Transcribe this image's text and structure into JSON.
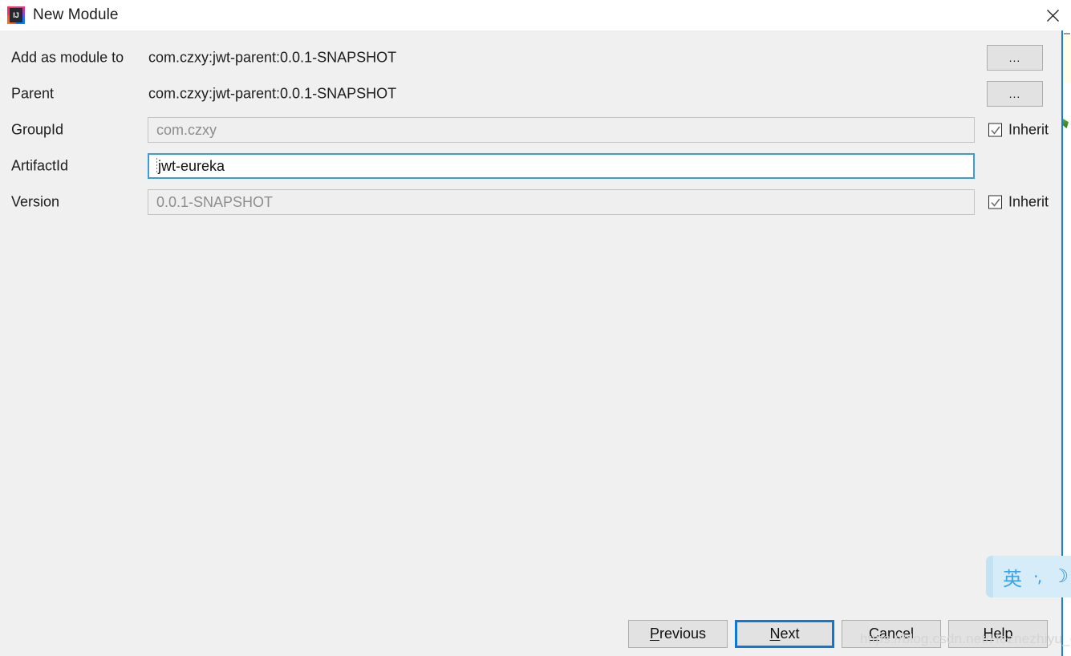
{
  "window": {
    "title": "New Module",
    "app_icon": "intellij-idea-icon",
    "app_icon_text": "IJ",
    "close_icon": "close-icon"
  },
  "form": {
    "rows": [
      {
        "label": "Add as module to",
        "type": "static",
        "value": "com.czxy:jwt-parent:0.0.1-SNAPSHOT",
        "trailing": "browse-button",
        "trailing_label": "...",
        "name": "add-as-module-to"
      },
      {
        "label": "Parent",
        "type": "static",
        "value": "com.czxy:jwt-parent:0.0.1-SNAPSHOT",
        "trailing": "browse-button",
        "trailing_label": "...",
        "name": "parent"
      },
      {
        "label": "GroupId",
        "type": "input",
        "value": "com.czxy",
        "state": "disabled",
        "trailing": "inherit-checkbox",
        "trailing_label": "Inherit",
        "checked": true,
        "name": "groupid"
      },
      {
        "label": "ArtifactId",
        "type": "input",
        "value": "jwt-eureka",
        "state": "focused",
        "trailing": "none",
        "trailing_label": "",
        "checked": false,
        "name": "artifactid"
      },
      {
        "label": "Version",
        "type": "input",
        "value": "0.0.1-SNAPSHOT",
        "state": "disabled",
        "trailing": "inherit-checkbox",
        "trailing_label": "Inherit",
        "checked": true,
        "name": "version"
      }
    ]
  },
  "ime": {
    "mode": "英",
    "punctuation": "·,",
    "moon": "☽"
  },
  "buttons": [
    {
      "label": "Previous",
      "mnemonic": "P",
      "focused": false,
      "name": "previous-button"
    },
    {
      "label": "Next",
      "mnemonic": "N",
      "focused": true,
      "name": "next-button"
    },
    {
      "label": "Cancel",
      "mnemonic": "C",
      "focused": false,
      "name": "cancel-button"
    },
    {
      "label": "Help",
      "mnemonic": "H",
      "focused": false,
      "name": "help-button"
    }
  ],
  "watermark": "https://blog.csdn.net/Heznezhiyu_e",
  "colors": {
    "titlebar_bg": "#ffffff",
    "dialog_bg": "#f0f0f0",
    "focus_blue": "#3c9ade",
    "button_focus_blue": "#1077d5",
    "disabled_field_bg": "#efefef",
    "disabled_text": "#8d8d8d",
    "ime_bg": "#d6ecf8",
    "ime_fg": "#3ba3e8"
  }
}
